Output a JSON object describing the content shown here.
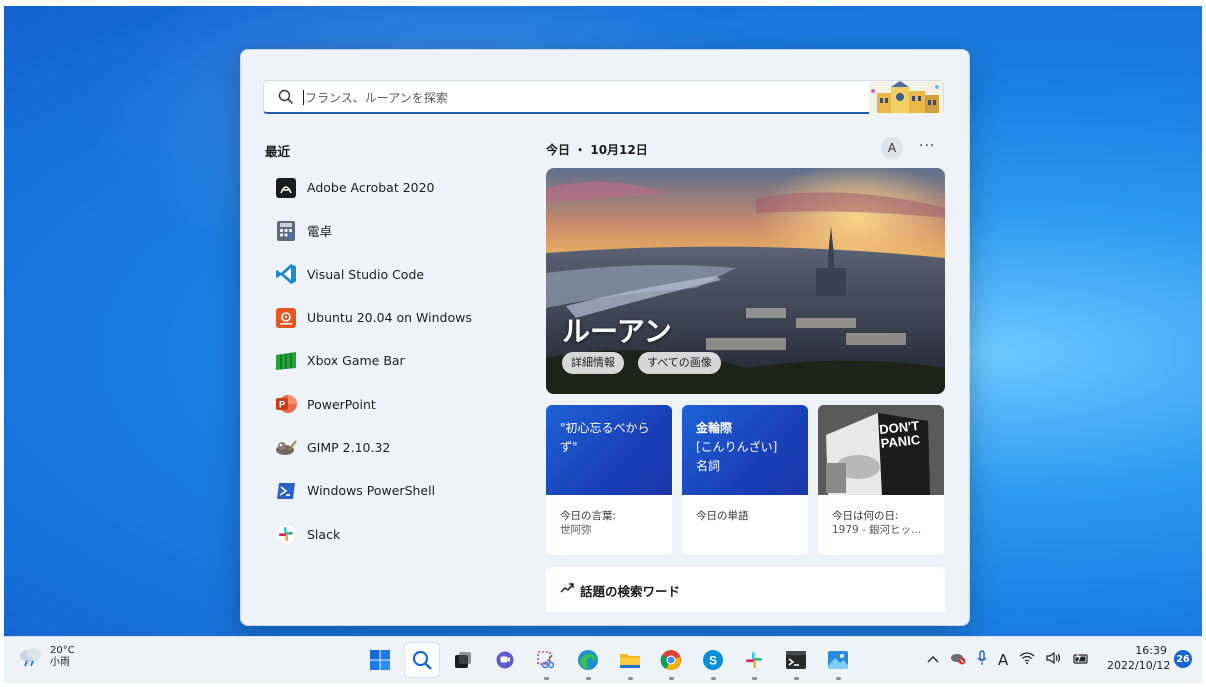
{
  "search": {
    "placeholder": "フランス、ルーアンを探索"
  },
  "recent": {
    "title": "最近",
    "items": [
      {
        "label": "Adobe Acrobat 2020",
        "icon": "adobe-acrobat-icon"
      },
      {
        "label": "電卓",
        "icon": "calculator-icon"
      },
      {
        "label": "Visual Studio Code",
        "icon": "vscode-icon"
      },
      {
        "label": "Ubuntu 20.04 on Windows",
        "icon": "ubuntu-icon"
      },
      {
        "label": "Xbox Game Bar",
        "icon": "xbox-game-bar-icon"
      },
      {
        "label": "PowerPoint",
        "icon": "powerpoint-icon"
      },
      {
        "label": "GIMP 2.10.32",
        "icon": "gimp-icon"
      },
      {
        "label": "Windows PowerShell",
        "icon": "powershell-icon"
      },
      {
        "label": "Slack",
        "icon": "slack-icon"
      }
    ]
  },
  "today": {
    "header": "今日 ・ 10月12日",
    "avatar_initial": "A",
    "more": "···",
    "hero": {
      "title": "ルーアン",
      "details_chip": "詳細情報",
      "images_chip": "すべての画像"
    },
    "cards": [
      {
        "top": "\"初心忘るべからず\"",
        "label": "今日の言葉:",
        "sub": "世阿弥"
      },
      {
        "top_title": "金輪際",
        "top_line2": "[こんりんざい]",
        "top_line3": "名詞",
        "label": "今日の単語"
      },
      {
        "image_text_1": "DON'T",
        "image_text_2": "PANIC",
        "label": "今日は何の日:",
        "sub": "1979 - 銀河ヒッ..."
      }
    ],
    "trending": "話題の検索ワード"
  },
  "taskbar": {
    "weather": {
      "temp": "20°C",
      "condition": "小雨"
    },
    "clock": {
      "time": "16:39",
      "date": "2022/10/12"
    },
    "ime": "A",
    "notification_count": "26",
    "apps": [
      "start-icon",
      "search-icon",
      "task-view-icon",
      "teams-chat-icon",
      "snipping-tool-icon",
      "edge-icon",
      "file-explorer-icon",
      "chrome-icon",
      "skype-icon",
      "slack-icon",
      "terminal-icon",
      "photos-icon"
    ]
  },
  "colors": {
    "accent": "#1a5fb4",
    "card_blue": "#1f62d6",
    "badge": "#1966d2"
  }
}
